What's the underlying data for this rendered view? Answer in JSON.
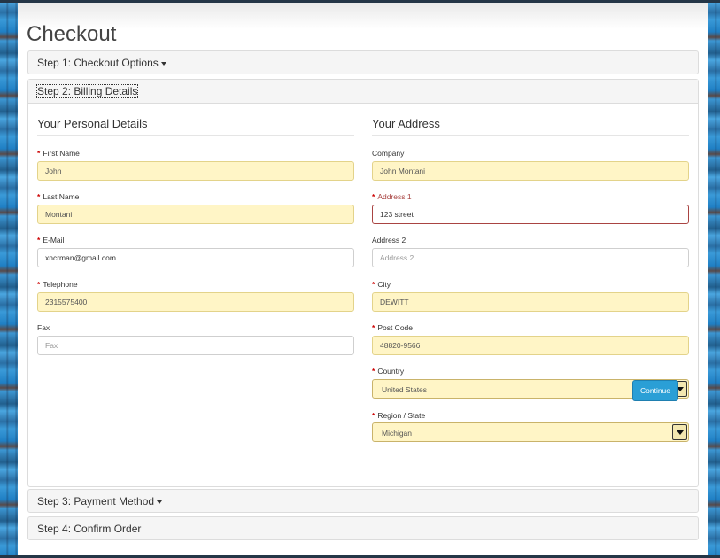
{
  "page_title": "Checkout",
  "steps": [
    {
      "label": "Step 1: Checkout Options"
    },
    {
      "label": "Step 2: Billing Details"
    },
    {
      "label": "Step 3: Payment Method"
    },
    {
      "label": "Step 4: Confirm Order"
    }
  ],
  "personal": {
    "title": "Your Personal Details",
    "first_name": {
      "label": "First Name",
      "value": "John"
    },
    "last_name": {
      "label": "Last Name",
      "value": "Montani"
    },
    "email": {
      "label": "E-Mail",
      "value": "xncrman@gmail.com"
    },
    "telephone": {
      "label": "Telephone",
      "value": "2315575400"
    },
    "fax": {
      "label": "Fax",
      "value": "",
      "placeholder": "Fax"
    }
  },
  "address": {
    "title": "Your Address",
    "company": {
      "label": "Company",
      "value": "John Montani"
    },
    "address1": {
      "label": "Address 1",
      "value": "123 street"
    },
    "address2": {
      "label": "Address 2",
      "value": "",
      "placeholder": "Address 2"
    },
    "city": {
      "label": "City",
      "value": "DEWITT"
    },
    "postcode": {
      "label": "Post Code",
      "value": "48820-9566"
    },
    "country": {
      "label": "Country",
      "value": "United States"
    },
    "region": {
      "label": "Region / State",
      "value": "Michigan"
    }
  },
  "continue_label": "Continue",
  "required_marker": "*",
  "colors": {
    "accent": "#2a9fd6",
    "autofill": "#fff5c6",
    "error": "#a94442",
    "required": "#cc0000"
  }
}
